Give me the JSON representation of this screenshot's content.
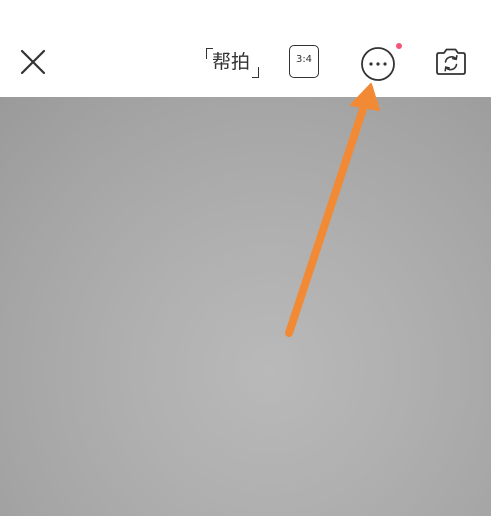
{
  "toolbar": {
    "close_icon": "close-icon",
    "helper_label": "帮拍",
    "ratio_label": "3:4",
    "more_icon": "more-icon",
    "flip_icon": "camera-flip-icon"
  },
  "colors": {
    "topbar": "#ffffff",
    "icon": "#333333",
    "notification_dot": "#f2557a",
    "viewfinder": "#b0b0b0",
    "annotation_arrow": "#f28a35"
  }
}
